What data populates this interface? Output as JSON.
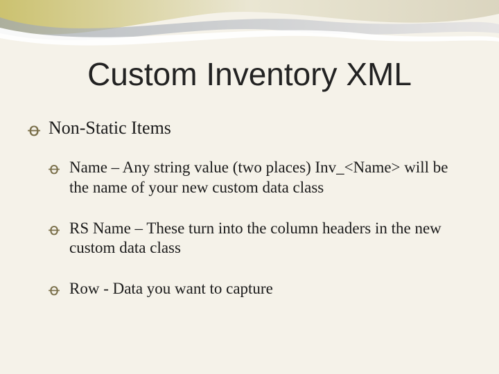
{
  "title": "Custom Inventory XML",
  "bullet_glyph": "་",
  "items": {
    "level1": "Non-Static Items",
    "sub1": "Name – Any string value (two places)  Inv_<Name> will be the name of your new custom data class",
    "sub2": "RS Name – These turn into the column headers in the new custom data class",
    "sub3": "Row - Data you want to capture"
  }
}
